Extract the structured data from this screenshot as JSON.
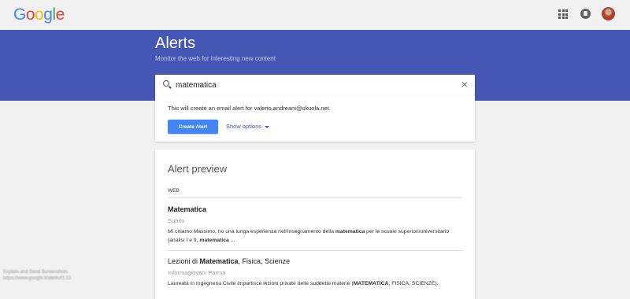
{
  "header": {
    "logo_letters": [
      "G",
      "o",
      "o",
      "g",
      "l",
      "e"
    ],
    "logo_colors": [
      "#4285f4",
      "#ea4335",
      "#fbbc05",
      "#4285f4",
      "#34a853",
      "#ea4335"
    ],
    "icons": [
      "apps-grid-icon",
      "notifications-icon",
      "avatar"
    ]
  },
  "banner": {
    "title": "Alerts",
    "subtitle": "Monitor the web for interesting new content",
    "color": "#4556b4"
  },
  "search": {
    "value": "matematica"
  },
  "create": {
    "note": "This will create an email alert for valerio.andreani@skuola.net.",
    "button_label": "Create Alert",
    "options_label": "Show options",
    "button_color": "#4285f4"
  },
  "preview": {
    "title": "Alert preview",
    "section": "WEB",
    "results": [
      {
        "title": "Matematica",
        "source": "Subito",
        "snippet_parts": [
          "Mi chiamo Massimo, ho una lunga esperienza nell'insegnamento della ",
          "matematica",
          " per le scuole superiori/universitario (analisi I e II, ",
          "matematica",
          " ..."
        ]
      },
      {
        "title_parts": [
          "Lezioni di ",
          "Matematica",
          ", Fisica, Scienze"
        ],
        "source": "Informagiovani Parma",
        "snippet_parts": [
          "Laureata in Ingegneria Civile impartisce lezioni private delle suddette materie (",
          "MATEMATICA",
          ", FISICA, SCIENZE)."
        ]
      }
    ]
  },
  "watermark": {
    "line1": "Explain and Send Screenshots",
    "line2": "https://www.google.it/alerts#1:13"
  }
}
